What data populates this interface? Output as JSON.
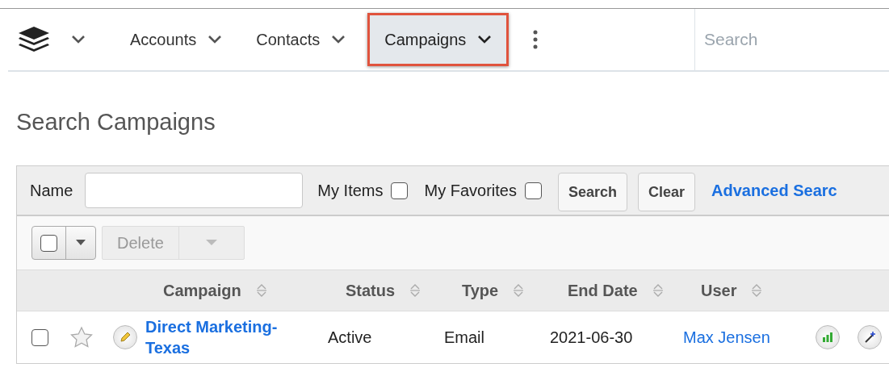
{
  "nav": {
    "items": [
      {
        "label": "Accounts",
        "selected": false
      },
      {
        "label": "Contacts",
        "selected": false
      },
      {
        "label": "Campaigns",
        "selected": true
      }
    ],
    "search": {
      "placeholder": "Search"
    }
  },
  "page_title": "Search Campaigns",
  "filter": {
    "name_label": "Name",
    "toggles": [
      {
        "label": "My Items",
        "checked": false
      },
      {
        "label": "My Favorites",
        "checked": false
      }
    ],
    "buttons": [
      "Search",
      "Clear"
    ],
    "advanced_link": "Advanced Searc"
  },
  "toolbar": {
    "select_all_checked": false,
    "delete_label": "Delete",
    "delete_disabled": true
  },
  "table": {
    "columns": [
      "Campaign",
      "Status",
      "Type",
      "End Date",
      "User"
    ],
    "rows": [
      {
        "checked": false,
        "favorite": false,
        "campaign": "Direct Marketing-Texas",
        "status": "Active",
        "type": "Email",
        "end_date": "2021-06-30",
        "user": "Max Jensen"
      }
    ]
  }
}
